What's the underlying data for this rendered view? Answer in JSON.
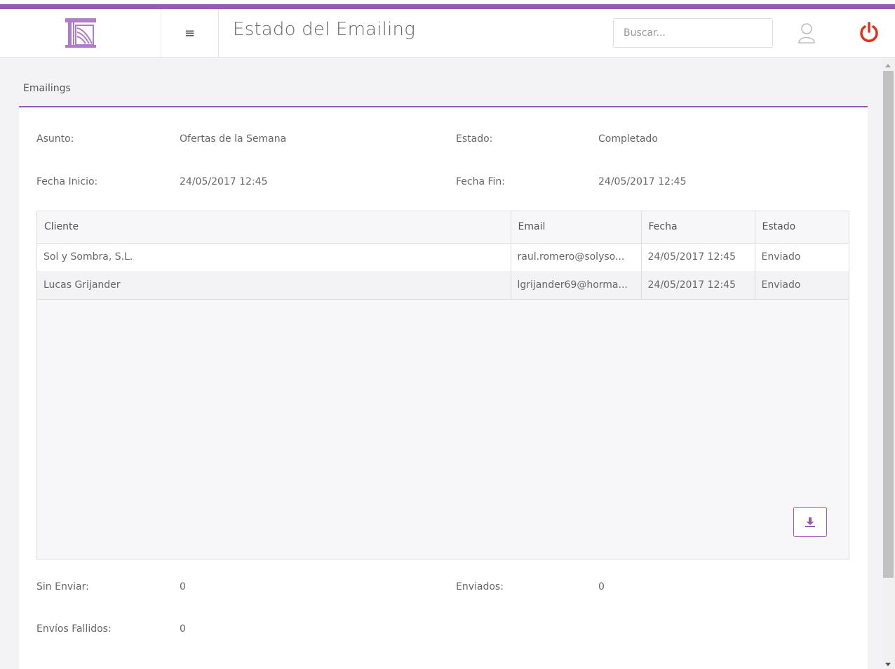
{
  "header": {
    "title": "Estado del Emailing",
    "search_placeholder": "Buscar...",
    "menu_icon": "hamburger-icon",
    "user_icon": "user-icon",
    "power_icon": "power-icon",
    "accent_color": "#9b59b6",
    "power_color": "#e0301e"
  },
  "panel": {
    "title": "Emailings"
  },
  "details": {
    "asunto_label": "Asunto:",
    "asunto_value": "Ofertas de la Semana",
    "estado_label": "Estado:",
    "estado_value": "Completado",
    "fecha_inicio_label": "Fecha Inicio:",
    "fecha_inicio_value": "24/05/2017 12:45",
    "fecha_fin_label": "Fecha Fin:",
    "fecha_fin_value": "24/05/2017 12:45"
  },
  "table": {
    "columns": [
      "Cliente",
      "Email",
      "Fecha",
      "Estado"
    ],
    "rows": [
      [
        "Sol y Sombra, S.L.",
        "raul.romero@solyso...",
        "24/05/2017 12:45",
        "Enviado"
      ],
      [
        "Lucas Grijander",
        "lgrijander69@horma...",
        "24/05/2017 12:45",
        "Enviado"
      ]
    ],
    "export_icon": "download-icon"
  },
  "summary": {
    "sin_enviar_label": "Sin Enviar:",
    "sin_enviar_value": "0",
    "enviados_label": "Enviados:",
    "enviados_value": "0",
    "fallidos_label": "Envíos Fallidos:",
    "fallidos_value": "0"
  }
}
